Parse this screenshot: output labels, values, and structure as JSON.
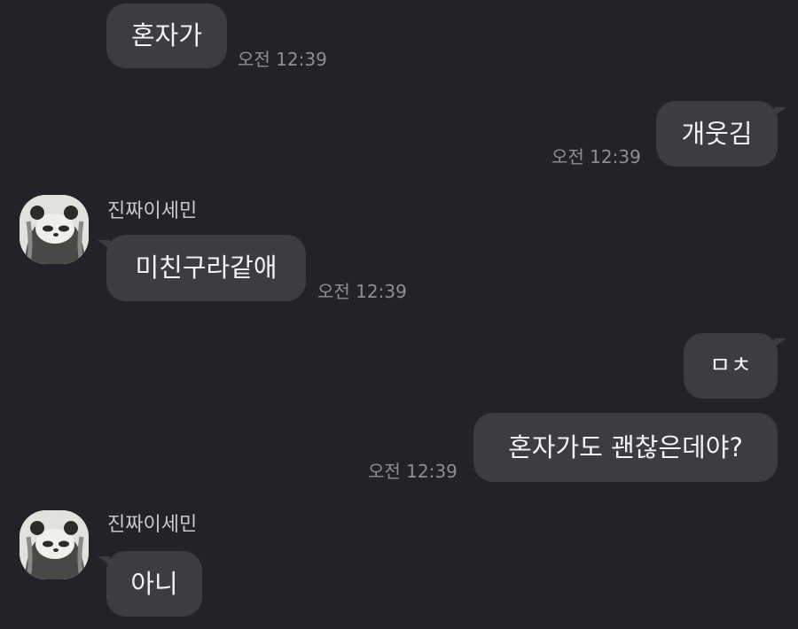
{
  "messages": [
    {
      "text": "혼자가",
      "time": "오전 12:39"
    },
    {
      "text": "개웃김",
      "time": "오전 12:39"
    },
    {
      "sender": "진짜이세민",
      "text": "미친구라같애",
      "time": "오전 12:39"
    },
    {
      "text": "ㅁㅊ"
    },
    {
      "text": "혼자가도 괜찮은데야?",
      "time": "오전 12:39"
    },
    {
      "sender": "진짜이세민",
      "text": "아니"
    }
  ]
}
